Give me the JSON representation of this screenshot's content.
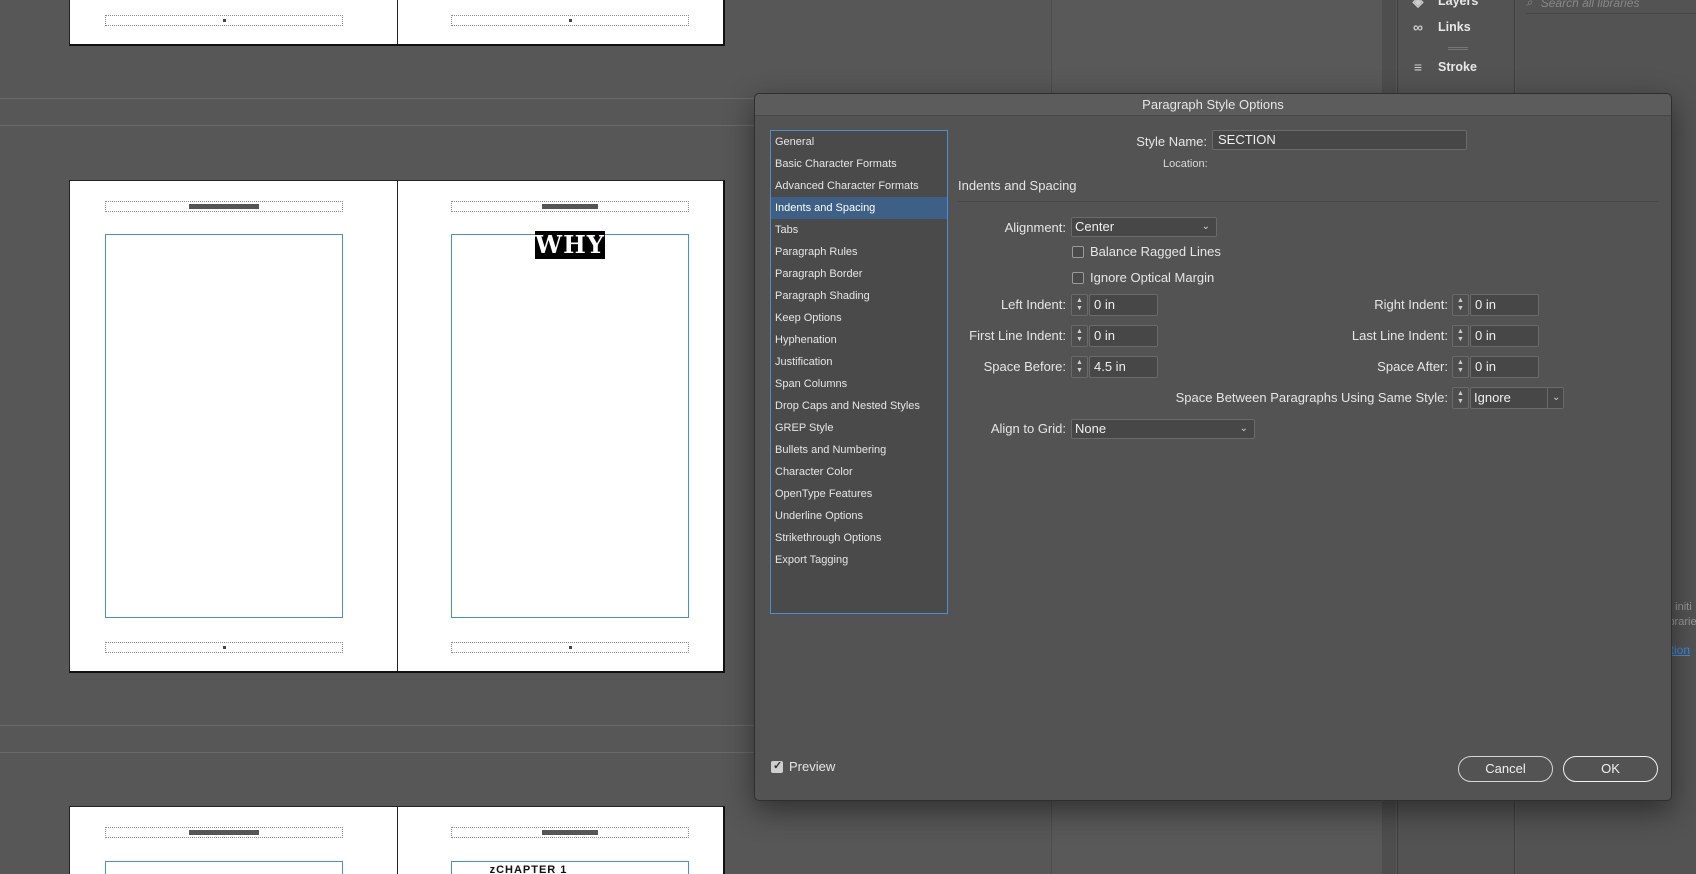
{
  "canvas": {
    "chapter_heading": "WHY",
    "chapter_label": "zCHAPTER 1"
  },
  "panels": {
    "items": [
      {
        "label": "Layers",
        "icon": "layers-icon"
      },
      {
        "label": "Links",
        "icon": "links-icon"
      },
      {
        "label": "Stroke",
        "icon": "stroke-icon"
      }
    ],
    "libraries": {
      "search_placeholder": "Search all libraries",
      "fragment_1": "g initi",
      "fragment_2": "ibrarie",
      "link_fragment": "ation"
    }
  },
  "dialog": {
    "title": "Paragraph Style Options",
    "categories": [
      "General",
      "Basic Character Formats",
      "Advanced Character Formats",
      "Indents and Spacing",
      "Tabs",
      "Paragraph Rules",
      "Paragraph Border",
      "Paragraph Shading",
      "Keep Options",
      "Hyphenation",
      "Justification",
      "Span Columns",
      "Drop Caps and Nested Styles",
      "GREP Style",
      "Bullets and Numbering",
      "Character Color",
      "OpenType Features",
      "Underline Options",
      "Strikethrough Options",
      "Export Tagging"
    ],
    "selected_category": "Indents and Spacing",
    "style_name_label": "Style Name:",
    "style_name_value": "SECTION",
    "location_label": "Location:",
    "section_title": "Indents and Spacing",
    "alignment": {
      "label": "Alignment:",
      "value": "Center"
    },
    "balance_ragged": {
      "label": "Balance Ragged Lines",
      "checked": false
    },
    "ignore_optical": {
      "label": "Ignore Optical Margin",
      "checked": false
    },
    "left_indent": {
      "label": "Left Indent:",
      "value": "0 in"
    },
    "right_indent": {
      "label": "Right Indent:",
      "value": "0 in"
    },
    "first_line_indent": {
      "label": "First Line Indent:",
      "value": "0 in"
    },
    "last_line_indent": {
      "label": "Last Line Indent:",
      "value": "0 in"
    },
    "space_before": {
      "label": "Space Before:",
      "value": "4.5 in"
    },
    "space_after": {
      "label": "Space After:",
      "value": "0 in"
    },
    "space_between": {
      "label": "Space Between Paragraphs Using Same Style:",
      "value": "Ignore"
    },
    "align_to_grid": {
      "label": "Align to Grid:",
      "value": "None"
    },
    "preview": {
      "label": "Preview",
      "checked": true
    },
    "cancel_label": "Cancel",
    "ok_label": "OK"
  }
}
